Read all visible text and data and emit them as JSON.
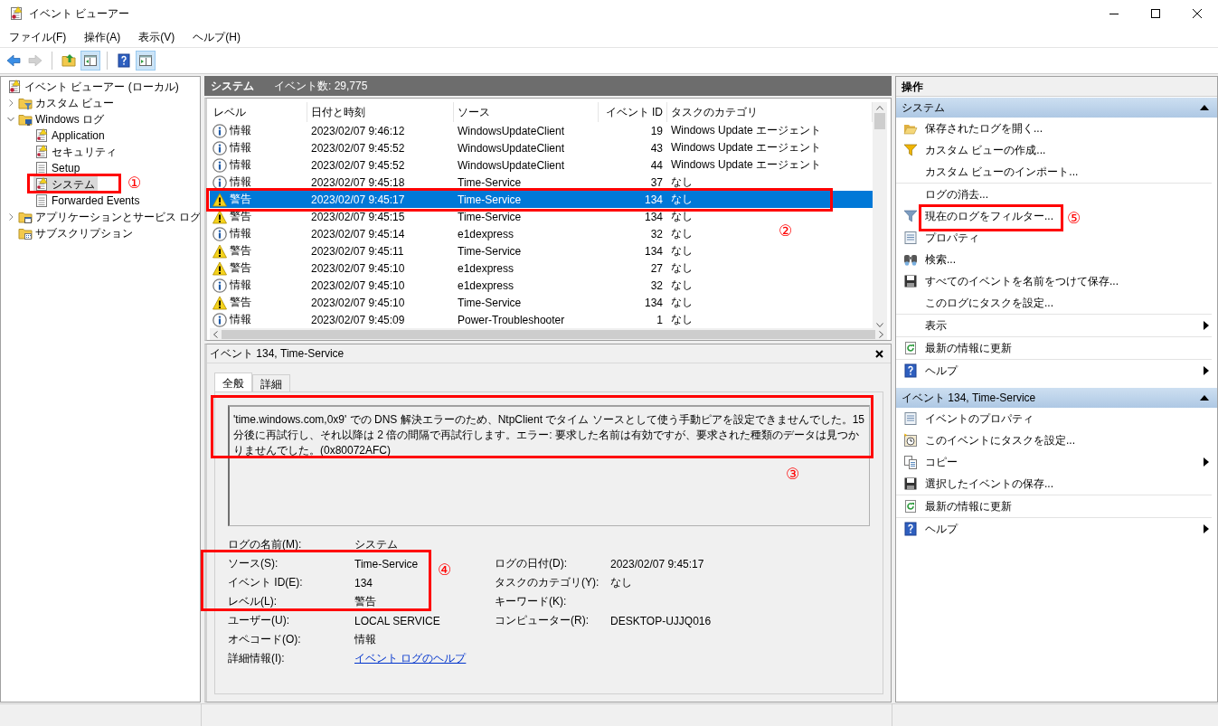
{
  "window": {
    "title": "イベント ビューアー"
  },
  "menu": [
    {
      "label": "ファイル(F)"
    },
    {
      "label": "操作(A)"
    },
    {
      "label": "表示(V)"
    },
    {
      "label": "ヘルプ(H)"
    }
  ],
  "toolbar": [
    {
      "kind": "back",
      "pressed": false,
      "disabled": false
    },
    {
      "kind": "forward",
      "pressed": false,
      "disabled": true
    },
    {
      "kind": "separator"
    },
    {
      "kind": "up",
      "pressed": false,
      "disabled": false
    },
    {
      "kind": "tree-pane",
      "pressed": true,
      "disabled": false
    },
    {
      "kind": "separator"
    },
    {
      "kind": "help",
      "pressed": false,
      "disabled": false
    },
    {
      "kind": "action-pane",
      "pressed": true,
      "disabled": false
    }
  ],
  "tree": [
    {
      "label": "イベント ビューアー (ローカル)",
      "kind": "viewer",
      "selected": false,
      "children": [
        {
          "label": "カスタム ビュー",
          "kind": "filter-folder",
          "expanded": false,
          "selected": false
        },
        {
          "label": "Windows ログ",
          "kind": "pc-folder",
          "expanded": true,
          "selected": false,
          "children": [
            {
              "label": "Application",
              "kind": "log",
              "selected": false
            },
            {
              "label": "セキュリティ",
              "kind": "log",
              "selected": false
            },
            {
              "label": "Setup",
              "kind": "plain-log",
              "selected": false
            },
            {
              "label": "システム",
              "kind": "log",
              "selected": true
            },
            {
              "label": "Forwarded Events",
              "kind": "plain-log",
              "selected": false
            }
          ]
        },
        {
          "label": "アプリケーションとサービス ログ",
          "kind": "app-folder",
          "expanded": false,
          "selected": false
        },
        {
          "label": "サブスクリプション",
          "kind": "sub-folder",
          "selected": false
        }
      ]
    }
  ],
  "list": {
    "title": "システム",
    "count": "イベント数: 29,775",
    "columns": [
      {
        "label": "レベル"
      },
      {
        "label": "日付と時刻"
      },
      {
        "label": "ソース"
      },
      {
        "label": "イベント ID"
      },
      {
        "label": "タスクのカテゴリ"
      }
    ],
    "rows": [
      {
        "kind": "info",
        "severity": "情報",
        "date": "2023/02/07 9:46:12",
        "source": "WindowsUpdateClient",
        "event_id": "19",
        "category": "Windows Update エージェント",
        "selected": false
      },
      {
        "kind": "info",
        "severity": "情報",
        "date": "2023/02/07 9:45:52",
        "source": "WindowsUpdateClient",
        "event_id": "43",
        "category": "Windows Update エージェント",
        "selected": false
      },
      {
        "kind": "info",
        "severity": "情報",
        "date": "2023/02/07 9:45:52",
        "source": "WindowsUpdateClient",
        "event_id": "44",
        "category": "Windows Update エージェント",
        "selected": false
      },
      {
        "kind": "info",
        "severity": "情報",
        "date": "2023/02/07 9:45:18",
        "source": "Time-Service",
        "event_id": "37",
        "category": "なし",
        "selected": false
      },
      {
        "kind": "warning",
        "severity": "警告",
        "date": "2023/02/07 9:45:17",
        "source": "Time-Service",
        "event_id": "134",
        "category": "なし",
        "selected": true
      },
      {
        "kind": "warning",
        "severity": "警告",
        "date": "2023/02/07 9:45:15",
        "source": "Time-Service",
        "event_id": "134",
        "category": "なし",
        "selected": false
      },
      {
        "kind": "info",
        "severity": "情報",
        "date": "2023/02/07 9:45:14",
        "source": "e1dexpress",
        "event_id": "32",
        "category": "なし",
        "selected": false
      },
      {
        "kind": "warning",
        "severity": "警告",
        "date": "2023/02/07 9:45:11",
        "source": "Time-Service",
        "event_id": "134",
        "category": "なし",
        "selected": false
      },
      {
        "kind": "warning",
        "severity": "警告",
        "date": "2023/02/07 9:45:10",
        "source": "e1dexpress",
        "event_id": "27",
        "category": "なし",
        "selected": false
      },
      {
        "kind": "info",
        "severity": "情報",
        "date": "2023/02/07 9:45:10",
        "source": "e1dexpress",
        "event_id": "32",
        "category": "なし",
        "selected": false
      },
      {
        "kind": "warning",
        "severity": "警告",
        "date": "2023/02/07 9:45:10",
        "source": "Time-Service",
        "event_id": "134",
        "category": "なし",
        "selected": false
      },
      {
        "kind": "info",
        "severity": "情報",
        "date": "2023/02/07 9:45:09",
        "source": "Power-Troubleshooter",
        "event_id": "1",
        "category": "なし",
        "selected": false
      }
    ]
  },
  "detail": {
    "title": "イベント 134, Time-Service",
    "tabs": [
      {
        "label": "全般",
        "selected": true
      },
      {
        "label": "詳細",
        "selected": false
      }
    ],
    "message": "'time.windows.com,0x9' での DNS 解決エラーのため、NtpClient でタイム ソースとして使う手動ピアを設定できませんでした。15 分後に再試行し、それ以降は 2 倍の間隔で再試行します。エラー: 要求した名前は有効ですが、要求された種類のデータは見つかりませんでした。(0x80072AFC)",
    "properties": [
      [
        {
          "label": "ログの名前(M):",
          "value": "システム",
          "kind": "text"
        }
      ],
      [
        {
          "label": "ソース(S):",
          "value": "Time-Service",
          "kind": "text"
        },
        {
          "label": "ログの日付(D):",
          "value": "2023/02/07 9:45:17",
          "kind": "text"
        }
      ],
      [
        {
          "label": "イベント ID(E):",
          "value": "134",
          "kind": "text"
        },
        {
          "label": "タスクのカテゴリ(Y):",
          "value": "なし",
          "kind": "text"
        }
      ],
      [
        {
          "label": "レベル(L):",
          "value": "警告",
          "kind": "text"
        },
        {
          "label": "キーワード(K):",
          "kind": "text"
        }
      ],
      [
        {
          "label": "ユーザー(U):",
          "value": "LOCAL SERVICE",
          "kind": "text"
        },
        {
          "label": "コンピューター(R):",
          "value": "DESKTOP-UJJQ016",
          "kind": "text"
        }
      ],
      [
        {
          "label": "オペコード(O):",
          "value": "情報",
          "kind": "text"
        }
      ],
      [
        {
          "label": "詳細情報(I):",
          "value": "イベント ログのヘルプ",
          "kind": "link"
        }
      ]
    ]
  },
  "actions": {
    "title": "操作",
    "sections": [
      {
        "title": "システム",
        "expanded": true,
        "items": [
          {
            "label": "保存されたログを開く...",
            "kind": "open-folder",
            "submenu": false,
            "divider": false
          },
          {
            "label": "カスタム ビューの作成...",
            "kind": "funnel-yellow",
            "submenu": false,
            "divider": false
          },
          {
            "label": "カスタム ビューのインポート...",
            "kind": "none",
            "submenu": false,
            "divider": true
          },
          {
            "label": "ログの消去...",
            "kind": "none",
            "submenu": false,
            "divider": false
          },
          {
            "label": "現在のログをフィルター...",
            "kind": "funnel-blue",
            "submenu": false,
            "divider": false
          },
          {
            "label": "プロパティ",
            "kind": "properties",
            "submenu": false,
            "divider": false
          },
          {
            "label": "検索...",
            "kind": "binoculars",
            "submenu": false,
            "divider": false
          },
          {
            "label": "すべてのイベントを名前をつけて保存...",
            "kind": "save",
            "submenu": false,
            "divider": false
          },
          {
            "label": "このログにタスクを設定...",
            "kind": "none",
            "submenu": false,
            "divider": true
          },
          {
            "label": "表示",
            "kind": "none",
            "submenu": true,
            "divider": true
          },
          {
            "label": "最新の情報に更新",
            "kind": "refresh",
            "submenu": false,
            "divider": true
          },
          {
            "label": "ヘルプ",
            "kind": "help",
            "submenu": true,
            "divider": false
          }
        ]
      },
      {
        "title": "イベント 134, Time-Service",
        "expanded": true,
        "items": [
          {
            "label": "イベントのプロパティ",
            "kind": "properties",
            "submenu": false,
            "divider": false
          },
          {
            "label": "このイベントにタスクを設定...",
            "kind": "task-clock",
            "submenu": false,
            "divider": false
          },
          {
            "label": "コピー",
            "kind": "copy",
            "submenu": true,
            "divider": false
          },
          {
            "label": "選択したイベントの保存...",
            "kind": "save",
            "submenu": false,
            "divider": true
          },
          {
            "label": "最新の情報に更新",
            "kind": "refresh",
            "submenu": false,
            "divider": true
          },
          {
            "label": "ヘルプ",
            "kind": "help",
            "submenu": true,
            "divider": false
          }
        ]
      }
    ]
  },
  "annotations": [
    {
      "number": "①"
    },
    {
      "number": "②"
    },
    {
      "number": "③"
    },
    {
      "number": "④"
    },
    {
      "number": "⑤"
    }
  ]
}
